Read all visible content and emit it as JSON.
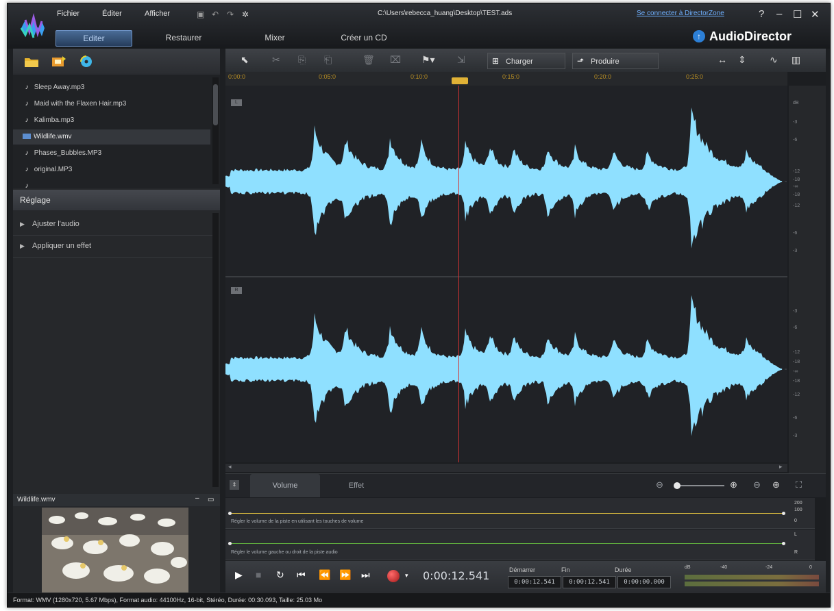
{
  "window": {
    "menu": [
      "Fichier",
      "Éditer",
      "Afficher"
    ],
    "file_path": "C:\\Users\\rebecca_huang\\Desktop\\TEST.ads",
    "connect_link": "Se connecter à DirectorZone",
    "help_label": "?",
    "brand": "AudioDirector"
  },
  "modes": [
    {
      "label": "Editer",
      "active": true
    },
    {
      "label": "Restaurer"
    },
    {
      "label": "Mixer"
    },
    {
      "label": "Créer un CD"
    }
  ],
  "library": {
    "files": [
      {
        "name": "Sleep Away.mp3",
        "type": "audio"
      },
      {
        "name": "Maid with the Flaxen Hair.mp3",
        "type": "audio"
      },
      {
        "name": "Kalimba.mp3",
        "type": "audio"
      },
      {
        "name": "Wildlife.wmv",
        "type": "video",
        "selected": true
      },
      {
        "name": "Phases_Bubbles.MP3",
        "type": "audio"
      },
      {
        "name": "original.MP3",
        "type": "audio"
      }
    ]
  },
  "adjust": {
    "title": "Réglage",
    "items": [
      "Ajuster l'audio",
      "Appliquer un effet"
    ]
  },
  "preview": {
    "title": "Wildlife.wmv"
  },
  "toolbar": {
    "load_label": "Charger",
    "produce_label": "Produire"
  },
  "ruler": {
    "ticks": [
      "0:00:0",
      "0:05:0",
      "0:10:0",
      "0:15:0",
      "0:20:0",
      "0:25:0"
    ]
  },
  "channels": {
    "left": "L",
    "right": "R"
  },
  "db_scale": {
    "top": [
      "dB",
      "-3",
      "-6",
      "-12",
      "-18",
      "-∞",
      "-18",
      "-12",
      "-6",
      "-3"
    ],
    "bottom": [
      "-3",
      "-6",
      "-12",
      "-18",
      "-∞",
      "-18",
      "-12",
      "-6",
      "-3"
    ]
  },
  "tabs": [
    {
      "label": "Volume",
      "active": true
    },
    {
      "label": "Effet"
    }
  ],
  "lanes": {
    "volume_hint": "Régler le volume de la piste en utilisant les touches de volume",
    "pan_hint": "Régler le volume gauche ou droit de la piste audio",
    "volume_scale": [
      "200",
      "100",
      "0"
    ],
    "pan_scale": [
      "L",
      "R"
    ]
  },
  "transport": {
    "timecode": "0:00:12.541",
    "start_label": "Démarrer",
    "end_label": "Fin",
    "duration_label": "Durée",
    "start_value": "0:00:12.541",
    "end_value": "0:00:12.541",
    "duration_value": "0:00:00.000",
    "meter_scale": [
      "dB",
      "-40",
      "-24",
      "0"
    ]
  },
  "status": "Format: WMV (1280x720, 5.67 Mbps), Format audio: 44100Hz, 16-bit, Stéréo, Durée: 00:30.093, Taille: 25.03 Mo",
  "colors": {
    "waveform": "#8fe0ff",
    "playhead": "#d03333",
    "accent": "#2c7fd6"
  }
}
